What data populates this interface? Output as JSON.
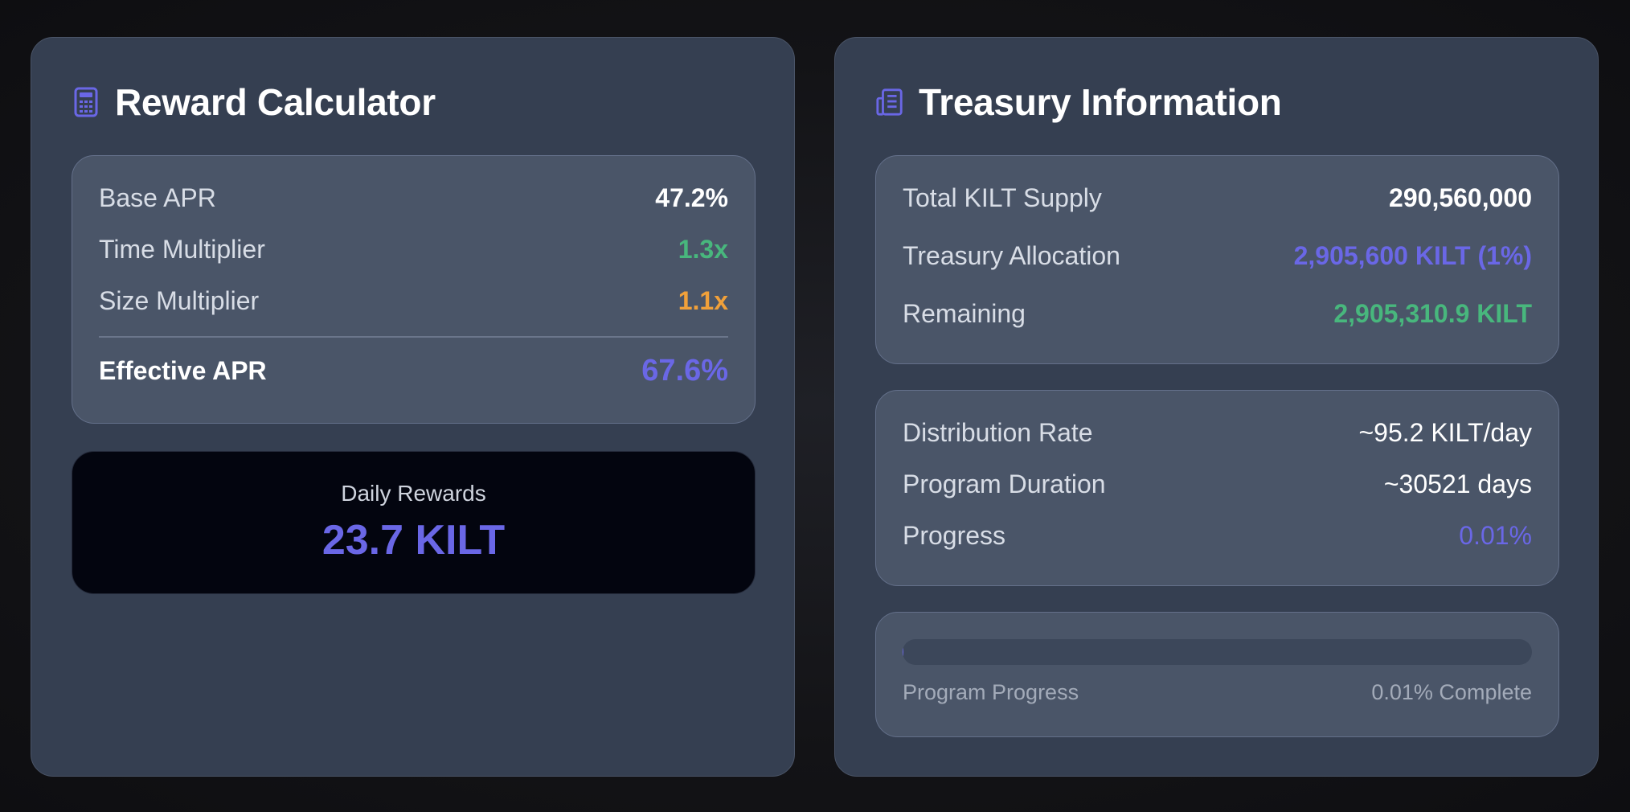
{
  "reward_calculator": {
    "title": "Reward Calculator",
    "icon": "calculator-icon",
    "rows": [
      {
        "label": "Base APR",
        "value": "47.2%",
        "color": "#ffffff"
      },
      {
        "label": "Time Multiplier",
        "value": "1.3x",
        "color": "#48b77d"
      },
      {
        "label": "Size Multiplier",
        "value": "1.1x",
        "color": "#f0a03a"
      }
    ],
    "effective": {
      "label": "Effective APR",
      "value": "67.6%",
      "color": "#6a67e6"
    },
    "daily": {
      "caption": "Daily Rewards",
      "amount": "23.7 KILT"
    }
  },
  "treasury": {
    "title": "Treasury Information",
    "icon": "treasury-icon",
    "supply": [
      {
        "label": "Total KILT Supply",
        "value": "290,560,000",
        "color": "#ffffff"
      },
      {
        "label": "Treasury Allocation",
        "value": "2,905,600 KILT (1%)",
        "color": "#6a67e6"
      },
      {
        "label": "Remaining",
        "value": "2,905,310.9 KILT",
        "color": "#48b77d"
      }
    ],
    "distribution": [
      {
        "label": "Distribution Rate",
        "value": "~95.2 KILT/day",
        "color": "#ffffff"
      },
      {
        "label": "Program Duration",
        "value": "~30521 days",
        "color": "#ffffff"
      },
      {
        "label": "Progress",
        "value": "0.01%",
        "color": "#6a67e6"
      }
    ],
    "progress_bar": {
      "label": "Program Progress",
      "status": "0.01% Complete",
      "percent": 0.01
    }
  }
}
